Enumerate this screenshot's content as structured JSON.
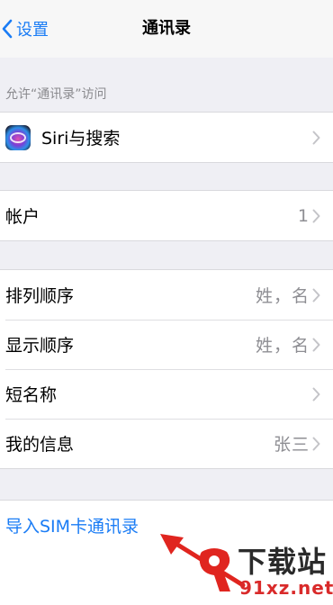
{
  "nav": {
    "back_label": "设置",
    "title": "通讯录"
  },
  "section_header": "允许“通讯录”访问",
  "access": {
    "siri_label": "Siri与搜索"
  },
  "accounts": {
    "label": "帐户",
    "value": "1"
  },
  "display": {
    "sort_order": {
      "label": "排列顺序",
      "value": "姓，名"
    },
    "display_order": {
      "label": "显示顺序",
      "value": "姓，名"
    },
    "short_name": {
      "label": "短名称"
    },
    "my_info": {
      "label": "我的信息",
      "value": "张三"
    }
  },
  "import": {
    "label": "导入SIM卡通讯录"
  },
  "watermark": {
    "title": "下载站",
    "url": "91xz.net"
  },
  "colors": {
    "accent": "#1a7cf5",
    "background": "#efeff4",
    "arrow": "#e0251f"
  },
  "icons": [
    "chevron-left-icon",
    "siri-icon",
    "chevron-right-icon",
    "arrow-icon"
  ]
}
